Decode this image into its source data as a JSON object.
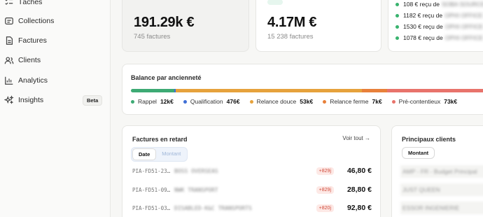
{
  "sidebar": {
    "items": [
      {
        "label": "Tâches",
        "icon": "task-list-icon"
      },
      {
        "label": "Collections",
        "icon": "collections-icon"
      },
      {
        "label": "Factures",
        "icon": "invoice-icon"
      },
      {
        "label": "Clients",
        "icon": "users-icon"
      },
      {
        "label": "Analytics",
        "icon": "bar-chart-icon"
      },
      {
        "label": "Insights",
        "icon": "sparkles-icon",
        "badge": "Beta"
      }
    ]
  },
  "kpis": [
    {
      "value": "191.29k €",
      "sub": "745 factures"
    },
    {
      "value": "4.17M €",
      "sub": "15 238 factures"
    }
  ],
  "payments": [
    {
      "amount": "108 € reçu de",
      "from": "SOBA SOURCE SAS"
    },
    {
      "amount": "1182 € reçu de",
      "from": "OPHI OFFICE SAS"
    },
    {
      "amount": "1530 € reçu de",
      "from": "OPHI OFFICE SAS"
    },
    {
      "amount": "1078 € reçu de",
      "from": "OPHI OFFICE SAS"
    }
  ],
  "aging": {
    "title": "Balance par ancienneté",
    "segments": [
      {
        "label": "Rappel",
        "value": "12k€",
        "color": "#3daa74"
      },
      {
        "label": "Qualification",
        "value": "476€",
        "color": "#3f6fd6"
      },
      {
        "label": "Relance douce",
        "value": "53k€",
        "color": "#e6a23c"
      },
      {
        "label": "Relance ferme",
        "value": "7k€",
        "color": "#e8803a"
      },
      {
        "label": "Pré-contentieux",
        "value": "73k€",
        "color": "#e8736b"
      }
    ]
  },
  "late": {
    "title": "Factures en retard",
    "see_all": "Voir tout →",
    "toggle": {
      "on": "Date",
      "off": "Montant"
    },
    "rows": [
      {
        "ref": "PIA-FD51-23…",
        "name": "BOSS OVERSEAS",
        "days": "+829j",
        "amount": "46,80 €"
      },
      {
        "ref": "PIA-FD51-09…",
        "name": "NWK TRANSPORT",
        "days": "+829j",
        "amount": "28,80 €"
      },
      {
        "ref": "PIA-FD51-03…",
        "name": "DISABLED-K&C TRANSPORTS",
        "days": "+820j",
        "amount": "92,80 €"
      }
    ]
  },
  "clients": {
    "title": "Principaux clients",
    "pill": "Montant",
    "items": [
      "AMP - FR - Budget Principal",
      "JUST QUEEN",
      "ESSOR INGENIERIE"
    ]
  }
}
